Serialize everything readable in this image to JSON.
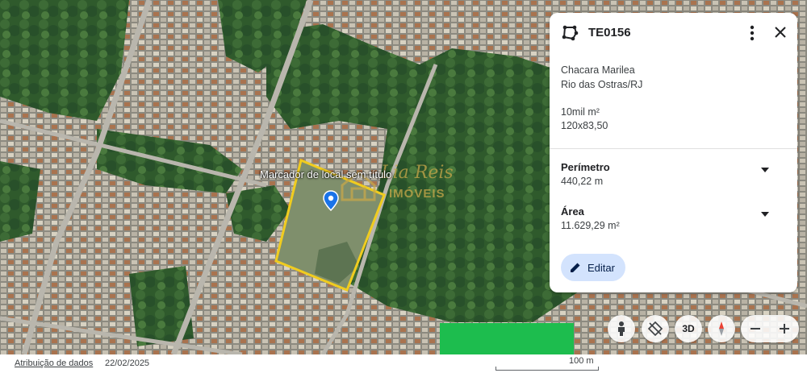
{
  "map": {
    "marker_label": "Marcador de local sem título",
    "watermark_script": "Lia Reis",
    "watermark_text": "IMÓVEIS"
  },
  "card": {
    "title": "TE0156",
    "description_lines": [
      "Chacara Marilea",
      "Rio das Ostras/RJ"
    ],
    "size_lines": [
      "10mil m²",
      "120x83,50"
    ],
    "perimeter": {
      "label": "Perímetro",
      "value": "440,22 m"
    },
    "area": {
      "label": "Área",
      "value": "11.629,29 m²"
    },
    "edit_label": "Editar"
  },
  "controls": {
    "view_3d_label": "3D"
  },
  "footer": {
    "attribution": "Atribuição de dados",
    "date": "22/02/2025",
    "scale": "100 m"
  },
  "colors": {
    "parcel_outline": "#f0cc1f",
    "pin": "#1a73e8",
    "edit_button_bg": "#d3e3fd",
    "green_block": "#1dbd4e"
  },
  "icons": [
    "polygon-icon",
    "more-vert-icon",
    "close-icon",
    "pin-icon",
    "pencil-icon",
    "pegman-icon",
    "tilt-icon",
    "compass-icon",
    "zoom-out-icon",
    "zoom-in-icon"
  ]
}
